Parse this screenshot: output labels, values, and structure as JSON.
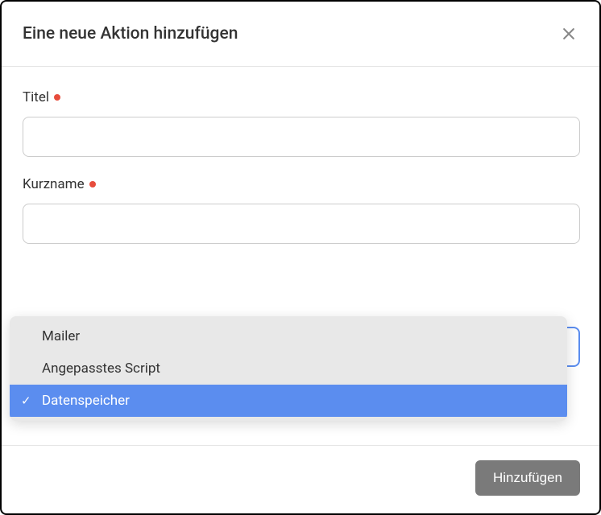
{
  "modal": {
    "title": "Eine neue Aktion hinzufügen"
  },
  "form": {
    "title_label": "Titel",
    "title_value": "",
    "shortname_label": "Kurzname",
    "shortname_value": ""
  },
  "dropdown": {
    "options": {
      "0": {
        "label": "Mailer",
        "selected": false
      },
      "1": {
        "label": "Angepasstes Script",
        "selected": false
      },
      "2": {
        "label": "Datenspeicher",
        "selected": true
      }
    }
  },
  "footer": {
    "submit_label": "Hinzufügen"
  }
}
